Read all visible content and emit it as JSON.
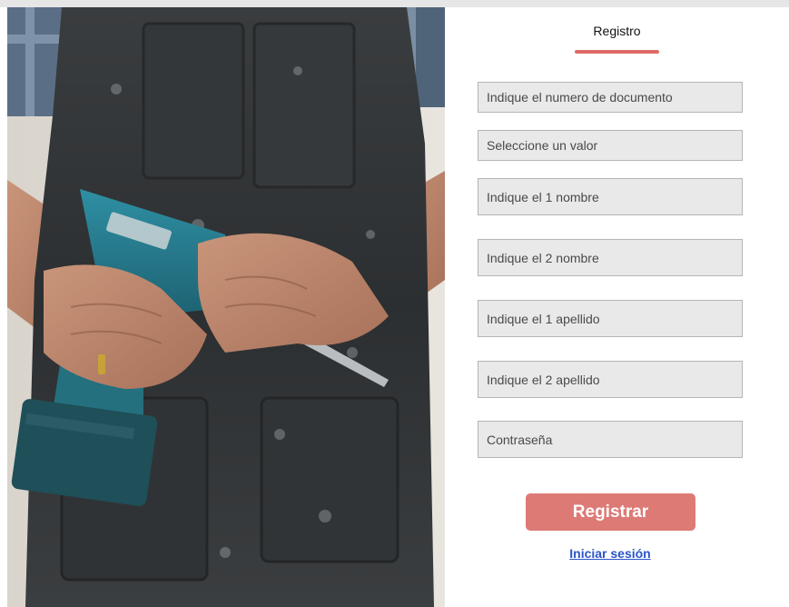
{
  "form": {
    "title": "Registro",
    "fields": {
      "document_number": {
        "placeholder": "Indique el numero de documento"
      },
      "document_type": {
        "placeholder": "Seleccione un valor"
      },
      "first_name": {
        "placeholder": "Indique el 1 nombre"
      },
      "second_name": {
        "placeholder": "Indique el 2 nombre"
      },
      "first_surname": {
        "placeholder": "Indique el 1 apellido"
      },
      "second_surname": {
        "placeholder": "Indique el 2 apellido"
      },
      "password": {
        "placeholder": "Contraseña"
      }
    },
    "submit_label": "Registrar",
    "login_link": "Iniciar sesión"
  },
  "colors": {
    "accent": "#e06b66",
    "button": "#dd7a76",
    "link": "#2a55c9",
    "field_bg": "#e9e9e9"
  }
}
